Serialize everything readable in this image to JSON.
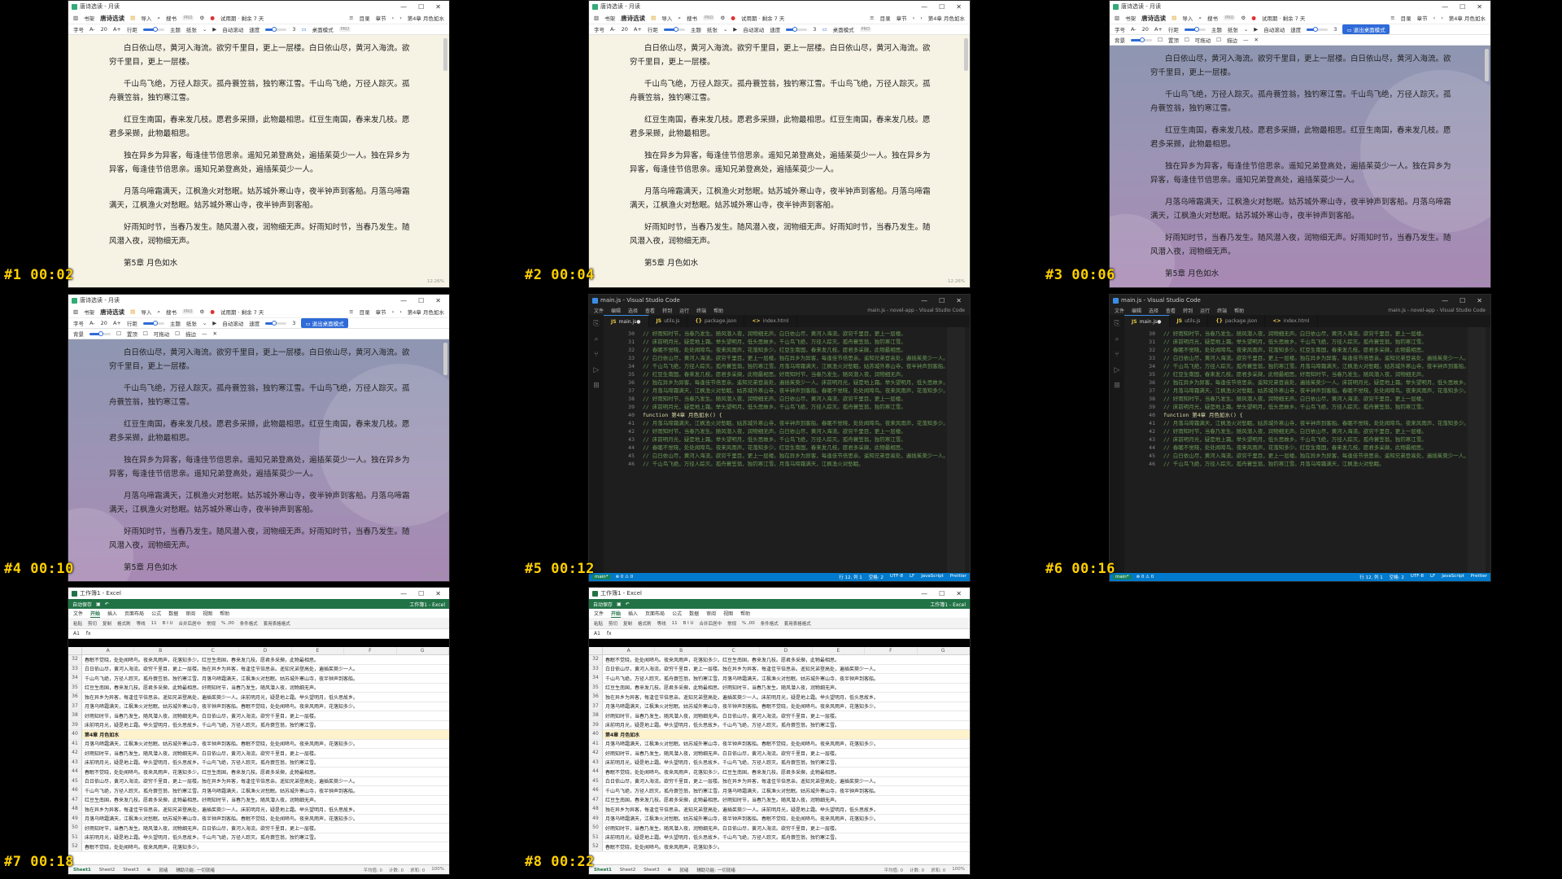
{
  "timestamps": [
    "#1 00:02",
    "#2 00:04",
    "#3 00:06",
    "#4 00:10",
    "#5 00:12",
    "#6 00:16",
    "#7 00:18",
    "#8 00:22"
  ],
  "reader": {
    "window_title": "唐诗选读 - 月读",
    "toolbar": {
      "bookshelf": "书架",
      "active_title": "唐诗选读",
      "import": "导入",
      "search": "搜书",
      "pro": "PRO",
      "trial": "试用期 · 剩余 7 天",
      "toc": "目录",
      "chapter_ctrl": "章节",
      "chapter_indicator": "第4章 月色如水",
      "font_size_label": "字号",
      "font_dec": "A-",
      "font_size_value": "20",
      "font_inc": "A+",
      "line_height_label": "行距",
      "theme_label": "主题",
      "theme_value": "纸张",
      "auto_scroll": "自动滚动",
      "speed_label": "速度",
      "speed_value": "3",
      "desktop_mode": "桌面模式",
      "exit_desktop_mode": "退出桌面模式",
      "background_label": "背景",
      "bg_opt1": "置顶",
      "bg_opt2": "可拖动",
      "bg_opt3": "描边"
    },
    "paragraphs": [
      "白日依山尽，黄河入海流。欲穷千里目，更上一层楼。白日依山尽，黄河入海流。欲穷千里目，更上一层楼。",
      "千山鸟飞绝，万径人踪灭。孤舟蓑笠翁，独钓寒江雪。千山鸟飞绝，万径人踪灭。孤舟蓑笠翁，独钓寒江雪。",
      "红豆生南国，春来发几枝。愿君多采撷，此物最相思。红豆生南国，春来发几枝。愿君多采撷，此物最相思。",
      "独在异乡为异客，每逢佳节倍思亲。遥知兄弟登高处，遍插茱萸少一人。独在异乡为异客，每逢佳节倍思亲。遥知兄弟登高处，遍插茱萸少一人。",
      "月落乌啼霜满天，江枫渔火对愁眠。姑苏城外寒山寺，夜半钟声到客船。月落乌啼霜满天，江枫渔火对愁眠。姑苏城外寒山寺，夜半钟声到客船。",
      "好雨知时节，当春乃发生。随风潜入夜，润物细无声。好雨知时节，当春乃发生。随风潜入夜，润物细无声。"
    ],
    "chapter_next": "第5章 月色如水",
    "progress": "12.26%"
  },
  "vscode": {
    "window_title": "main.js - Visual Studio Code",
    "menu": [
      "文件",
      "编辑",
      "选择",
      "查看",
      "转到",
      "运行",
      "终端",
      "帮助"
    ],
    "menu_right": "main.js - novel-app - Visual Studio Code",
    "tabs": [
      {
        "name": "main.js",
        "active": true
      },
      {
        "name": "utils.js",
        "active": false
      },
      {
        "name": "package.json",
        "active": false
      },
      {
        "name": "index.html",
        "active": false
      }
    ],
    "lines": [
      {
        "n": "30",
        "t": "// 好雨知时节，当春乃发生。随风潜入夜，润物细无声。白日依山尽，黄河入海流。欲穷千里目，更上一层楼。"
      },
      {
        "n": "31",
        "t": "// 床前明月光，疑是地上霜。举头望明月，低头思故乡。千山鸟飞绝，万径人踪灭。孤舟蓑笠翁，独钓寒江雪。"
      },
      {
        "n": "32",
        "t": "// 春眠不觉晓，处处闻啼鸟。夜来风雨声，花落知多少。红豆生南国，春来发几枝。愿君多采撷，此物最相思。"
      },
      {
        "n": "33",
        "t": "// 白日依山尽，黄河入海流。欲穷千里目，更上一层楼。独在异乡为异客，每逢佳节倍思亲。遥知兄弟登高处，遍插茱萸少一人。"
      },
      {
        "n": "34",
        "t": "// 千山鸟飞绝，万径人踪灭。孤舟蓑笠翁，独钓寒江雪。月落乌啼霜满天，江枫渔火对愁眠。姑苏城外寒山寺，夜半钟声到客船。"
      },
      {
        "n": "35",
        "t": "// 红豆生南国，春来发几枝。愿君多采撷，此物最相思。好雨知时节，当春乃发生。随风潜入夜，润物细无声。"
      },
      {
        "n": "36",
        "t": "// 独在异乡为异客，每逢佳节倍思亲。遥知兄弟登高处，遍插茱萸少一人。床前明月光，疑是地上霜。举头望明月，低头思故乡。"
      },
      {
        "n": "37",
        "t": "// 月落乌啼霜满天，江枫渔火对愁眠。姑苏城外寒山寺，夜半钟声到客船。春眠不觉晓，处处闻啼鸟。夜来风雨声，花落知多少。"
      },
      {
        "n": "38",
        "t": "// 好雨知时节，当春乃发生。随风潜入夜，润物细无声。白日依山尽，黄河入海流。欲穷千里目，更上一层楼。"
      },
      {
        "n": "39",
        "t": "// 床前明月光，疑是地上霜。举头望明月，低头思故乡。千山鸟飞绝，万径人踪灭。孤舟蓑笠翁，独钓寒江雪。"
      },
      {
        "n": "40",
        "t": "function 第4章 月色如水() {"
      },
      {
        "n": "41",
        "t": "// 月落乌啼霜满天，江枫渔火对愁眠。姑苏城外寒山寺，夜半钟声到客船。春眠不觉晓，处处闻啼鸟。夜来风雨声，花落知多少。"
      },
      {
        "n": "42",
        "t": "// 好雨知时节，当春乃发生。随风潜入夜，润物细无声。白日依山尽，黄河入海流。欲穷千里目，更上一层楼。"
      },
      {
        "n": "43",
        "t": "// 床前明月光，疑是地上霜。举头望明月，低头思故乡。千山鸟飞绝，万径人踪灭。孤舟蓑笠翁，独钓寒江雪。"
      },
      {
        "n": "44",
        "t": "// 春眠不觉晓，处处闻啼鸟。夜来风雨声，花落知多少。红豆生南国，春来发几枝。愿君多采撷，此物最相思。"
      },
      {
        "n": "45",
        "t": "// 白日依山尽，黄河入海流。欲穷千里目，更上一层楼。独在异乡为异客，每逢佳节倍思亲。遥知兄弟登高处，遍插茱萸少一人。"
      },
      {
        "n": "46",
        "t": "// 千山鸟飞绝，万径人踪灭。孤舟蓑笠翁，独钓寒江雪。月落乌啼霜满天，江枫渔火对愁眠。"
      }
    ],
    "status": {
      "branch": "main*",
      "errors": "⊗ 0 ⚠ 0",
      "pos": "行 12, 列 1",
      "spaces": "空格: 2",
      "enc": "UTF-8",
      "eol": "LF",
      "lang": "JavaScript",
      "fmt": "Prettier"
    }
  },
  "excel": {
    "window_title": "工作簿1 - Excel",
    "autosave": "自动保存",
    "top_right": "工作簿1 - Excel",
    "tabs": [
      "文件",
      "开始",
      "插入",
      "页面布局",
      "公式",
      "数据",
      "审阅",
      "视图",
      "帮助"
    ],
    "ribbon": [
      "粘贴",
      "剪切",
      "复制",
      "格式刷",
      "等线",
      "11",
      "B I U",
      "合并后居中",
      "常规",
      "% ,00",
      "条件格式",
      "套用表格格式"
    ],
    "cell_ref": "A1",
    "fx": "fx",
    "columns": [
      "A",
      "B",
      "C",
      "D",
      "E",
      "F",
      "G"
    ],
    "rows": [
      {
        "n": "32",
        "t": "春眠不觉晓，处处闻啼鸟。夜来风雨声，花落知多少。红豆生南国，春来发几枝。愿君多采撷，此物最相思。"
      },
      {
        "n": "33",
        "t": "白日依山尽，黄河入海流。欲穷千里目，更上一层楼。独在异乡为异客，每逢佳节倍思亲。遥知兄弟登高处，遍插茱萸少一人。"
      },
      {
        "n": "34",
        "t": "千山鸟飞绝，万径人踪灭。孤舟蓑笠翁，独钓寒江雪。月落乌啼霜满天，江枫渔火对愁眠。姑苏城外寒山寺，夜半钟声到客船。"
      },
      {
        "n": "35",
        "t": "红豆生南国，春来发几枝。愿君多采撷，此物最相思。好雨知时节，当春乃发生。随风潜入夜，润物细无声。"
      },
      {
        "n": "36",
        "t": "独在异乡为异客，每逢佳节倍思亲。遥知兄弟登高处，遍插茱萸少一人。床前明月光，疑是地上霜。举头望明月，低头思故乡。"
      },
      {
        "n": "37",
        "t": "月落乌啼霜满天，江枫渔火对愁眠。姑苏城外寒山寺，夜半钟声到客船。春眠不觉晓，处处闻啼鸟。夜来风雨声，花落知多少。"
      },
      {
        "n": "38",
        "t": "好雨知时节，当春乃发生。随风潜入夜，润物细无声。白日依山尽，黄河入海流。欲穷千里目，更上一层楼。"
      },
      {
        "n": "39",
        "t": "床前明月光，疑是地上霜。举头望明月，低头思故乡。千山鸟飞绝，万径人踪灭。孤舟蓑笠翁，独钓寒江雪。"
      },
      {
        "n": "40",
        "t": "第4章 月色如水",
        "hl": true
      },
      {
        "n": "41",
        "t": "月落乌啼霜满天，江枫渔火对愁眠。姑苏城外寒山寺，夜半钟声到客船。春眠不觉晓，处处闻啼鸟。夜来风雨声，花落知多少。"
      },
      {
        "n": "42",
        "t": "好雨知时节，当春乃发生。随风潜入夜，润物细无声。白日依山尽，黄河入海流。欲穷千里目，更上一层楼。"
      },
      {
        "n": "43",
        "t": "床前明月光，疑是地上霜。举头望明月，低头思故乡。千山鸟飞绝，万径人踪灭。孤舟蓑笠翁，独钓寒江雪。"
      },
      {
        "n": "44",
        "t": "春眠不觉晓，处处闻啼鸟。夜来风雨声，花落知多少。红豆生南国，春来发几枝。愿君多采撷，此物最相思。"
      },
      {
        "n": "45",
        "t": "白日依山尽，黄河入海流。欲穷千里目，更上一层楼。独在异乡为异客，每逢佳节倍思亲。遥知兄弟登高处，遍插茱萸少一人。"
      },
      {
        "n": "46",
        "t": "千山鸟飞绝，万径人踪灭。孤舟蓑笠翁，独钓寒江雪。月落乌啼霜满天，江枫渔火对愁眠。姑苏城外寒山寺，夜半钟声到客船。"
      },
      {
        "n": "47",
        "t": "红豆生南国，春来发几枝。愿君多采撷，此物最相思。好雨知时节，当春乃发生。随风潜入夜，润物细无声。"
      },
      {
        "n": "48",
        "t": "独在异乡为异客，每逢佳节倍思亲。遥知兄弟登高处，遍插茱萸少一人。床前明月光，疑是地上霜。举头望明月，低头思故乡。"
      },
      {
        "n": "49",
        "t": "月落乌啼霜满天，江枫渔火对愁眠。姑苏城外寒山寺，夜半钟声到客船。春眠不觉晓，处处闻啼鸟。夜来风雨声，花落知多少。"
      },
      {
        "n": "50",
        "t": "好雨知时节，当春乃发生。随风潜入夜，润物细无声。白日依山尽，黄河入海流。欲穷千里目，更上一层楼。"
      },
      {
        "n": "51",
        "t": "床前明月光，疑是地上霜。举头望明月，低头思故乡。千山鸟飞绝，万径人踪灭。孤舟蓑笠翁，独钓寒江雪。"
      },
      {
        "n": "52",
        "t": "春眠不觉晓，处处闻啼鸟。夜来风雨声，花落知多少。"
      }
    ],
    "sheets": [
      "Sheet1",
      "Sheet2",
      "Sheet3"
    ],
    "status_left": "就绪",
    "status_mid": "辅助功能: 一切就绪",
    "status_right": [
      "平均值: 0",
      "计数: 0",
      "求和: 0"
    ],
    "zoom": "100%"
  },
  "colors": {
    "accent": "#2f6bd8",
    "excel_green": "#217346",
    "vscode_blue": "#007acc",
    "timestamp": "#ffd000"
  }
}
